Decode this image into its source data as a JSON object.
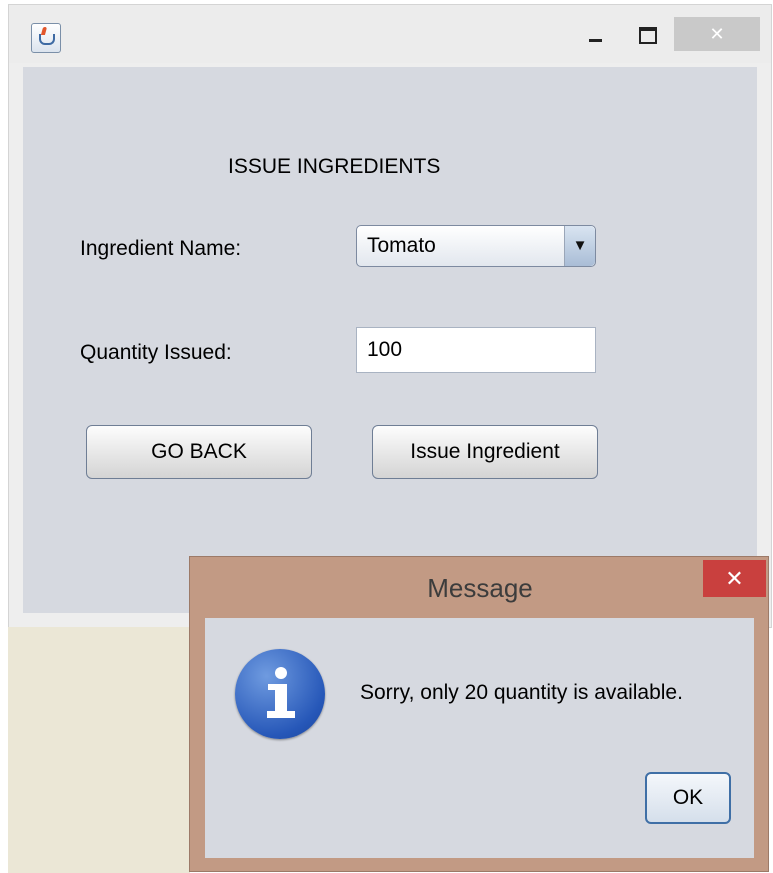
{
  "window": {
    "minimize_glyph": "",
    "maximize_glyph": "",
    "close_glyph": "✕"
  },
  "form": {
    "heading": "ISSUE INGREDIENTS",
    "ingredient_label": "Ingredient Name:",
    "ingredient_value": "Tomato",
    "dropdown_arrow": "▼",
    "quantity_label": "Quantity Issued:",
    "quantity_value": "100",
    "go_back_label": "GO BACK",
    "issue_label": "Issue Ingredient"
  },
  "dialog": {
    "title": "Message",
    "close_glyph": "✕",
    "message": "Sorry, only 20 quantity is available.",
    "ok_label": "OK"
  },
  "icons": {
    "app": "java-app-icon",
    "info": "info-icon"
  },
  "colors": {
    "dialog_frame": "#c29a84",
    "close_red": "#c9403e",
    "panel": "#d6d9e0"
  }
}
